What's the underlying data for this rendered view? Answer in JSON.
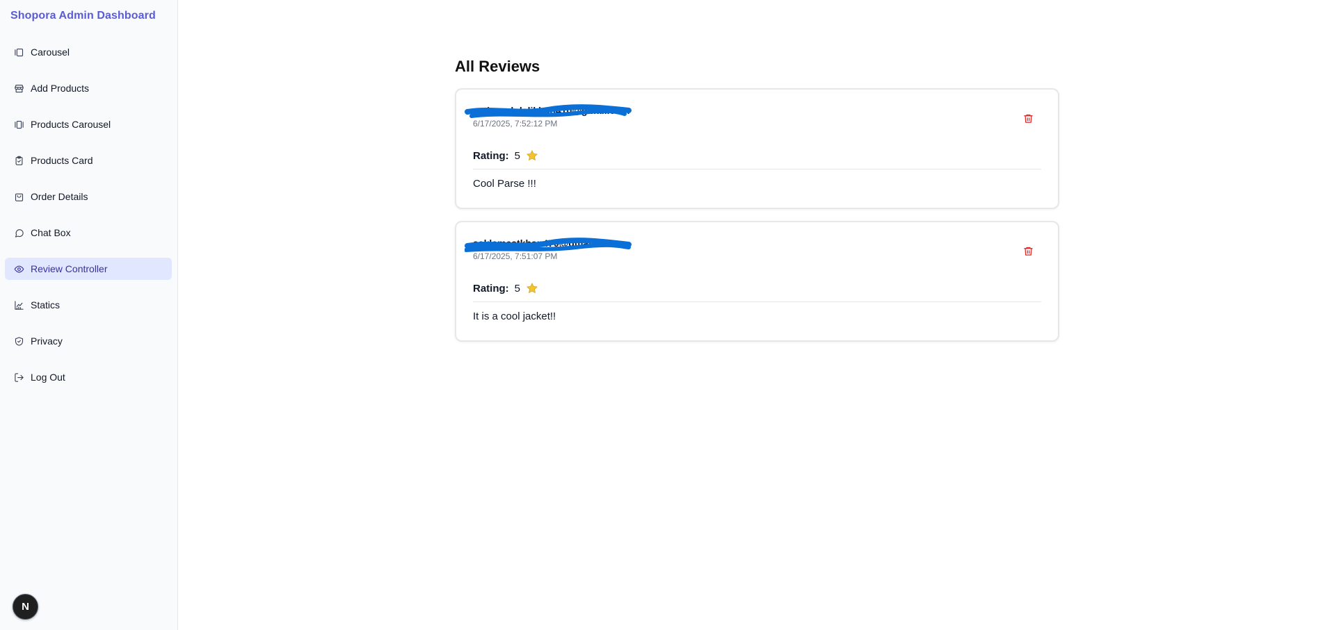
{
  "brand": "Shopora Admin Dashboard",
  "sidebar": {
    "items": [
      {
        "label": "Carousel",
        "icon": "carousel-icon"
      },
      {
        "label": "Add Products",
        "icon": "store-icon"
      },
      {
        "label": "Products Carousel",
        "icon": "gallery-icon"
      },
      {
        "label": "Products Card",
        "icon": "clipboard-icon"
      },
      {
        "label": "Order Details",
        "icon": "shopping-bag-icon"
      },
      {
        "label": "Chat Box",
        "icon": "chat-icon"
      },
      {
        "label": "Review Controller",
        "icon": "eye-icon",
        "active": true
      },
      {
        "label": "Statics",
        "icon": "chart-icon"
      },
      {
        "label": "Privacy",
        "icon": "shield-icon"
      },
      {
        "label": "Log Out",
        "icon": "logout-icon"
      }
    ]
  },
  "badge": "N",
  "main": {
    "title": "All Reviews",
    "rating_label": "Rating:",
    "reviews": [
      {
        "email": "mahmudulalikhan410@gmail.com",
        "date": "6/17/2025, 7:52:12 PM",
        "rating": "5",
        "comment": "Cool Parse !!!"
      },
      {
        "email": "saklameatkhan470@gmail.com",
        "date": "6/17/2025, 7:51:07 PM",
        "rating": "5",
        "comment": "It is a cool jacket!!"
      }
    ]
  },
  "colors": {
    "brand": "#5b5bd6",
    "active_bg": "#e0e7ff",
    "active_text": "#3730a3",
    "delete": "#dc2626",
    "star": "#f4c430",
    "scribble": "#0a6fd6"
  }
}
